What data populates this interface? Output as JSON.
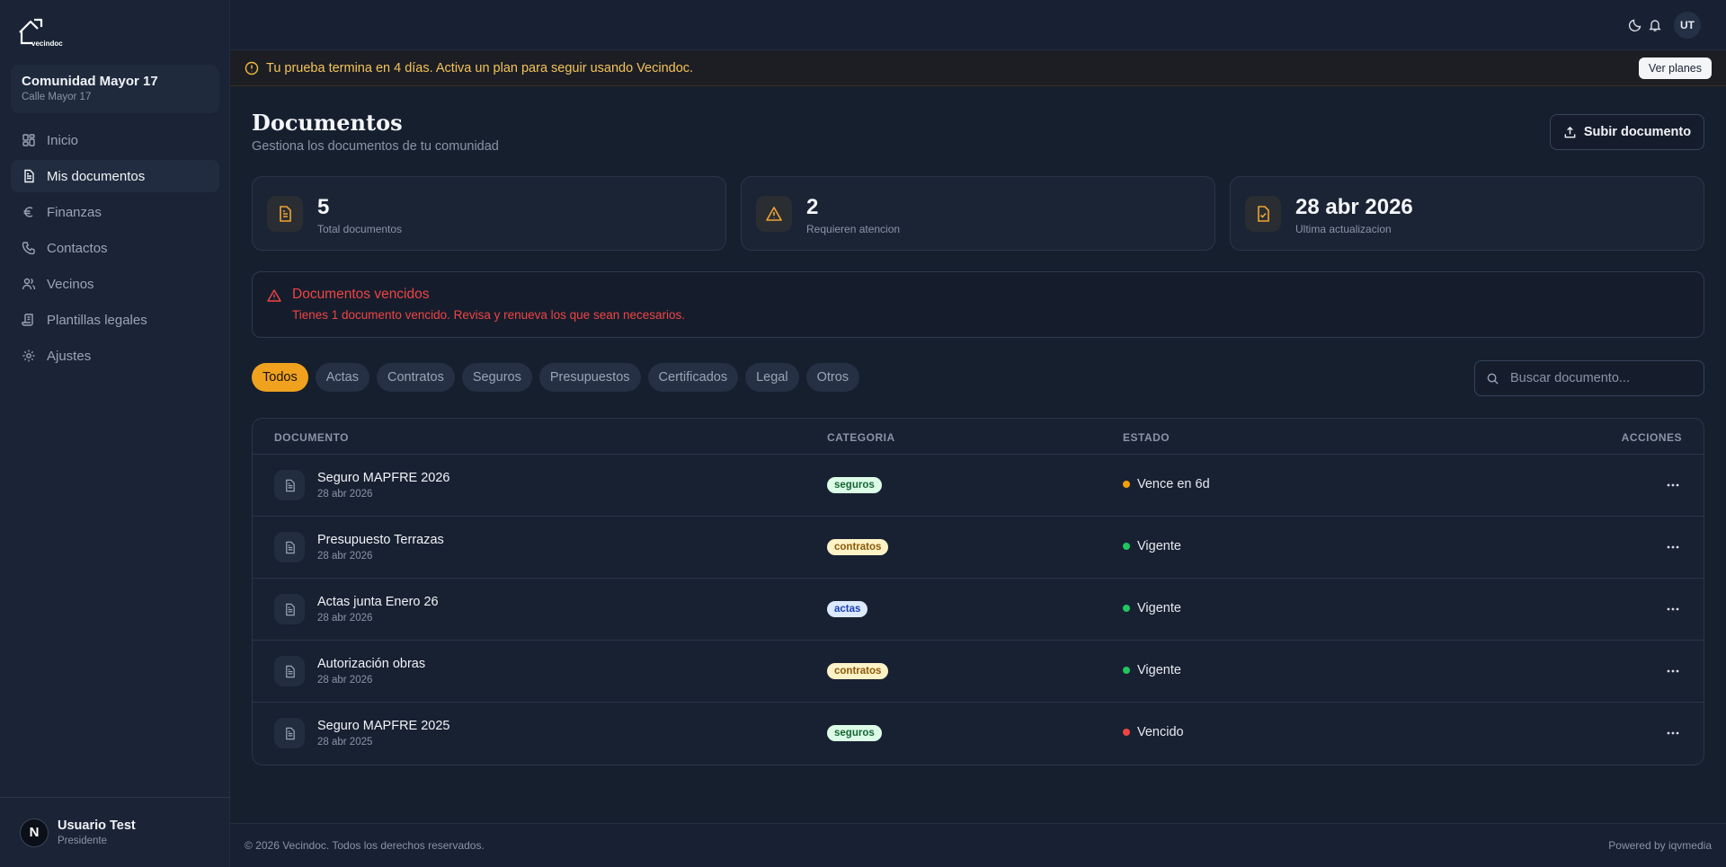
{
  "app": {
    "logo_text": "vecindoc"
  },
  "community": {
    "name": "Comunidad Mayor 17",
    "address": "Calle Mayor 17"
  },
  "sidebar": {
    "items": [
      {
        "label": "Inicio",
        "icon": "grid-icon",
        "active": false
      },
      {
        "label": "Mis documentos",
        "icon": "document-icon",
        "active": true
      },
      {
        "label": "Finanzas",
        "icon": "euro-icon",
        "active": false
      },
      {
        "label": "Contactos",
        "icon": "phone-icon",
        "active": false
      },
      {
        "label": "Vecinos",
        "icon": "users-icon",
        "active": false
      },
      {
        "label": "Plantillas legales",
        "icon": "scroll-icon",
        "active": false
      },
      {
        "label": "Ajustes",
        "icon": "gear-icon",
        "active": false
      }
    ]
  },
  "user": {
    "initial": "N",
    "name": "Usuario Test",
    "role": "Presidente"
  },
  "topbar": {
    "avatar_initials": "UT"
  },
  "banner": {
    "text": "Tu prueba termina en 4 días. Activa un plan para seguir usando Vecindoc.",
    "button": "Ver planes"
  },
  "page": {
    "title": "Documentos",
    "subtitle": "Gestiona los documentos de tu comunidad",
    "upload_button": "Subir documento"
  },
  "stats": [
    {
      "value": "5",
      "label": "Total documentos",
      "icon": "document-icon"
    },
    {
      "value": "2",
      "label": "Requieren atencion",
      "icon": "warning-icon"
    },
    {
      "value": "28 abr 2026",
      "label": "Ultima actualizacion",
      "icon": "document-check-icon"
    }
  ],
  "alert": {
    "title": "Documentos vencidos",
    "text": "Tienes 1 documento vencido. Revisa y renueva los que sean necesarios."
  },
  "filters": [
    "Todos",
    "Actas",
    "Contratos",
    "Seguros",
    "Presupuestos",
    "Certificados",
    "Legal",
    "Otros"
  ],
  "active_filter": "Todos",
  "search": {
    "placeholder": "Buscar documento..."
  },
  "table": {
    "headers": {
      "document": "DOCUMENTO",
      "category": "CATEGORIA",
      "status": "ESTADO",
      "actions": "ACCIONES"
    },
    "rows": [
      {
        "name": "Seguro MAPFRE 2026",
        "date": "28 abr 2026",
        "category": "seguros",
        "status": "Vence en 6d",
        "status_color": "#f59e0b"
      },
      {
        "name": "Presupuesto Terrazas",
        "date": "28 abr 2026",
        "category": "contratos",
        "status": "Vigente",
        "status_color": "#22c55e"
      },
      {
        "name": "Actas junta Enero 26",
        "date": "28 abr 2026",
        "category": "actas",
        "status": "Vigente",
        "status_color": "#22c55e"
      },
      {
        "name": "Autorización obras",
        "date": "28 abr 2026",
        "category": "contratos",
        "status": "Vigente",
        "status_color": "#22c55e"
      },
      {
        "name": "Seguro MAPFRE 2025",
        "date": "28 abr 2025",
        "category": "seguros",
        "status": "Vencido",
        "status_color": "#ef4444"
      }
    ]
  },
  "footer": {
    "copyright": "© 2026 Vecindoc. Todos los derechos reservados.",
    "powered": "Powered by iqvmedia"
  },
  "colors": {
    "accent": "#f0a21f",
    "background": "#161f2e",
    "danger": "#ef4444"
  }
}
